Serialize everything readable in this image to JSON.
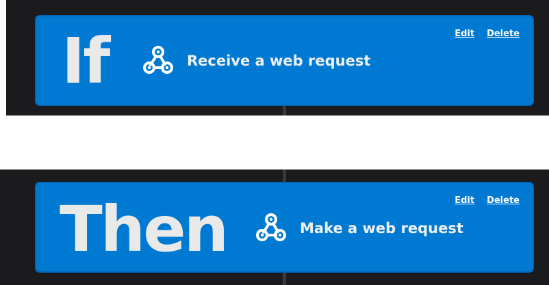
{
  "colors": {
    "card": "#0079d3",
    "background_dark": "#1b1b1d",
    "keyword": "#e9e9e9"
  },
  "trigger": {
    "keyword": "If",
    "icon": "webhook-icon",
    "label": "Receive a web request",
    "edit_label": "Edit",
    "delete_label": "Delete"
  },
  "action": {
    "keyword": "Then",
    "icon": "webhook-icon",
    "label": "Make a web request",
    "edit_label": "Edit",
    "delete_label": "Delete"
  }
}
